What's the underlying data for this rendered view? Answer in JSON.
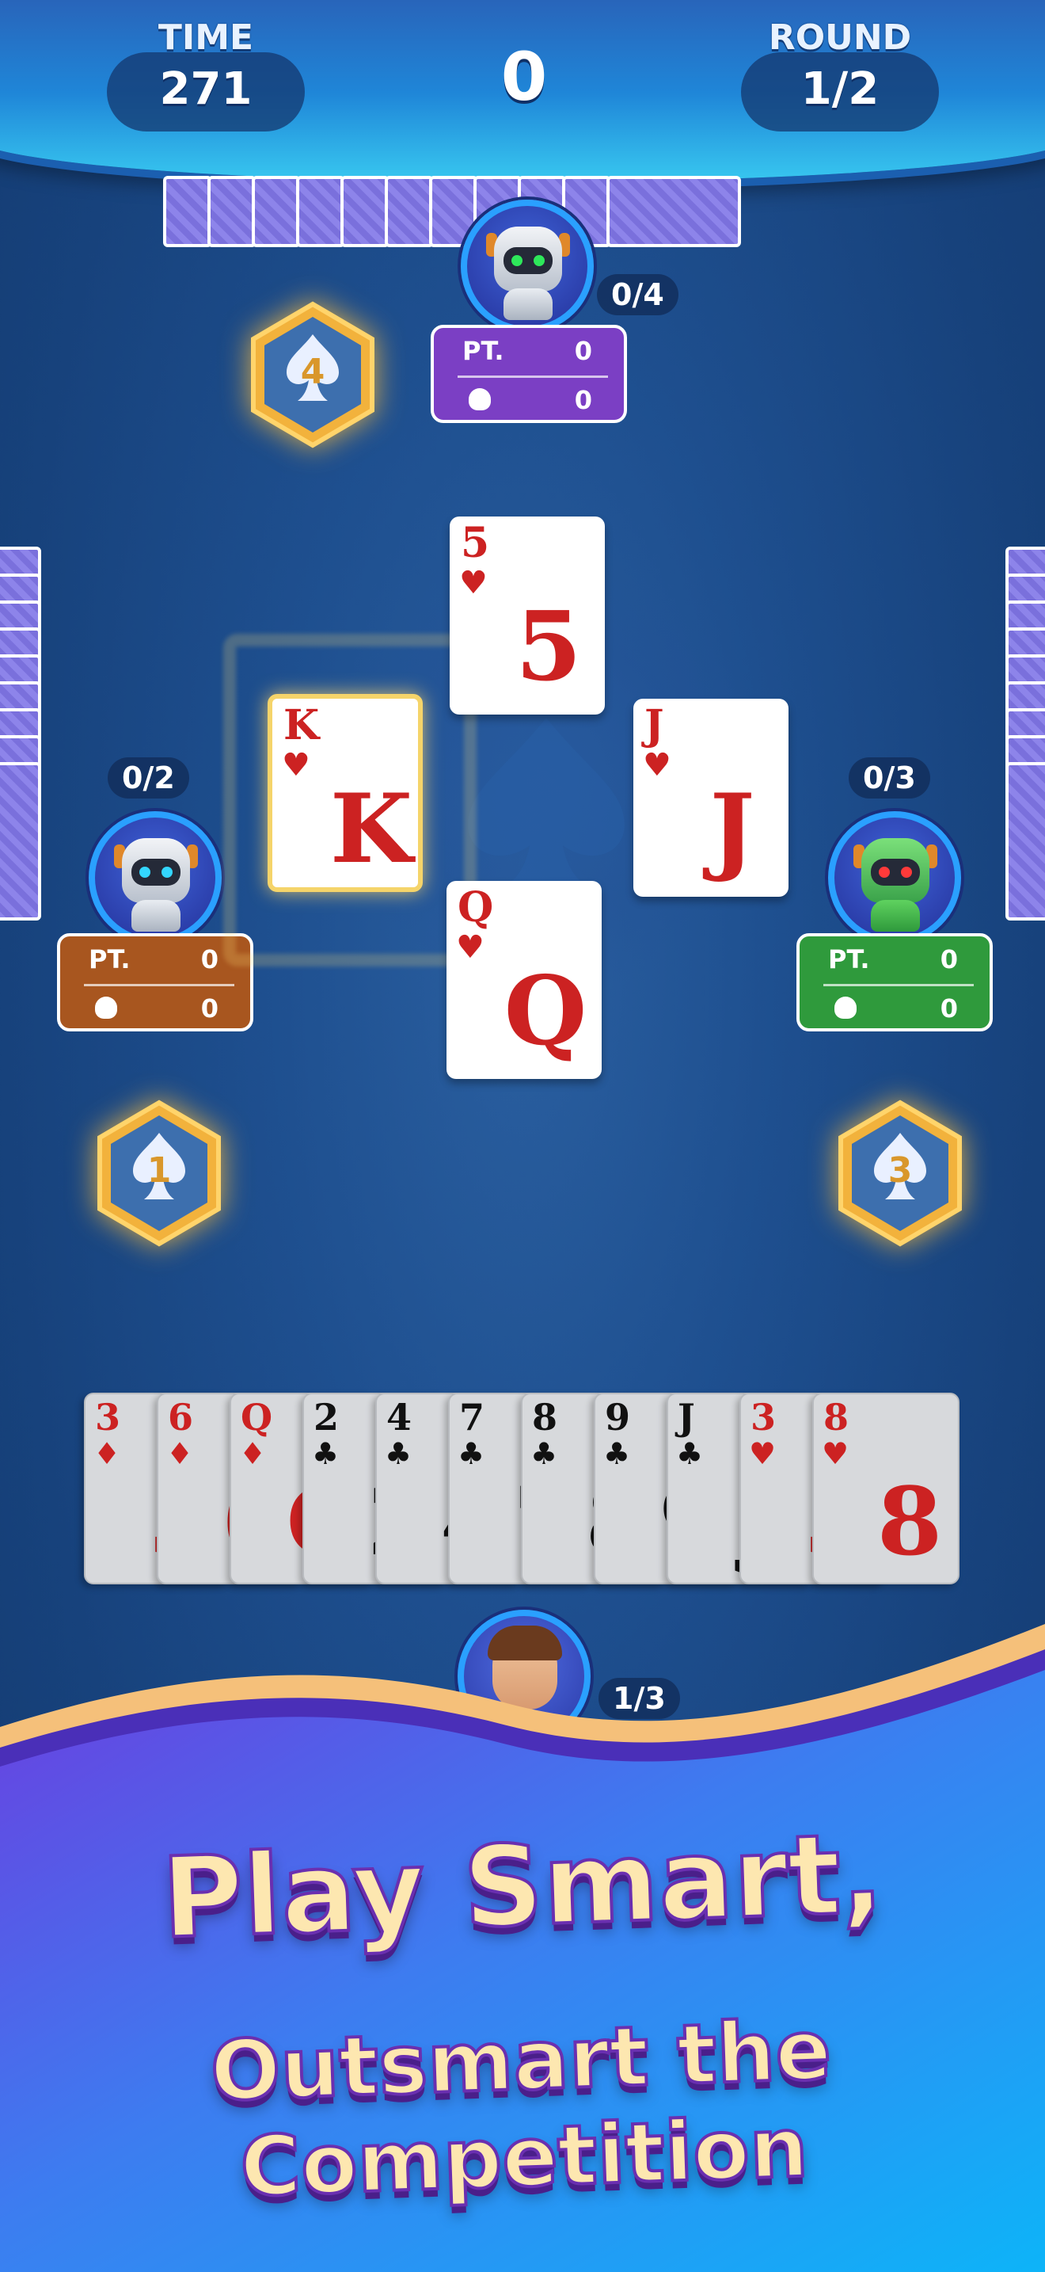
{
  "header": {
    "time_label": "TIME",
    "time_value": "271",
    "score_value": "0",
    "round_label": "ROUND",
    "round_value": "1/2"
  },
  "players": {
    "top": {
      "tricks": "0/4",
      "points_label": "PT.",
      "points_value": "0",
      "bags_value": "0",
      "seat_number": "4",
      "panel_color": "#7b3fc4",
      "eye_color": "#2ee85a"
    },
    "left": {
      "tricks": "0/2",
      "points_label": "PT.",
      "points_value": "0",
      "bags_value": "0",
      "seat_number": "1",
      "panel_color": "#a8561f",
      "eye_color": "#33d6ff"
    },
    "right": {
      "tricks": "0/3",
      "points_label": "PT.",
      "points_value": "0",
      "bags_value": "0",
      "seat_number": "3",
      "panel_color": "#2f9a3c",
      "eye_color": "#ff3a3a"
    },
    "bottom": {
      "tricks": "1/3"
    }
  },
  "trick": {
    "top": {
      "rank": "5",
      "suit": "♥"
    },
    "left": {
      "rank": "K",
      "suit": "♥"
    },
    "right": {
      "rank": "J",
      "suit": "♥"
    },
    "bottom": {
      "rank": "Q",
      "suit": "♥"
    }
  },
  "hand": [
    {
      "rank": "3",
      "suit": "♦",
      "color": "#cc2222",
      "big": "3"
    },
    {
      "rank": "6",
      "suit": "♦",
      "color": "#cc2222",
      "big": "6"
    },
    {
      "rank": "Q",
      "suit": "♦",
      "color": "#cc2222",
      "big": "Q"
    },
    {
      "rank": "2",
      "suit": "♣",
      "color": "#111111",
      "big": "2"
    },
    {
      "rank": "4",
      "suit": "♣",
      "color": "#111111",
      "big": "4"
    },
    {
      "rank": "7",
      "suit": "♣",
      "color": "#111111",
      "big": "7"
    },
    {
      "rank": "8",
      "suit": "♣",
      "color": "#111111",
      "big": "8"
    },
    {
      "rank": "9",
      "suit": "♣",
      "color": "#111111",
      "big": "9"
    },
    {
      "rank": "J",
      "suit": "♣",
      "color": "#111111",
      "big": "J"
    },
    {
      "rank": "3",
      "suit": "♥",
      "color": "#cc2222",
      "big": "3"
    },
    {
      "rank": "8",
      "suit": "♥",
      "color": "#cc2222",
      "big": "8"
    }
  ],
  "banner": {
    "line1": "Play Smart,",
    "line2": "Outsmart the Competition"
  },
  "colors": {
    "table": "#1e4f8f",
    "header_accent": "#38c8f0",
    "card_back": "#8d84ea",
    "banner_top": "#6a3fe0",
    "banner_bottom": "#0db4f8",
    "headline": "#fde7b0"
  }
}
